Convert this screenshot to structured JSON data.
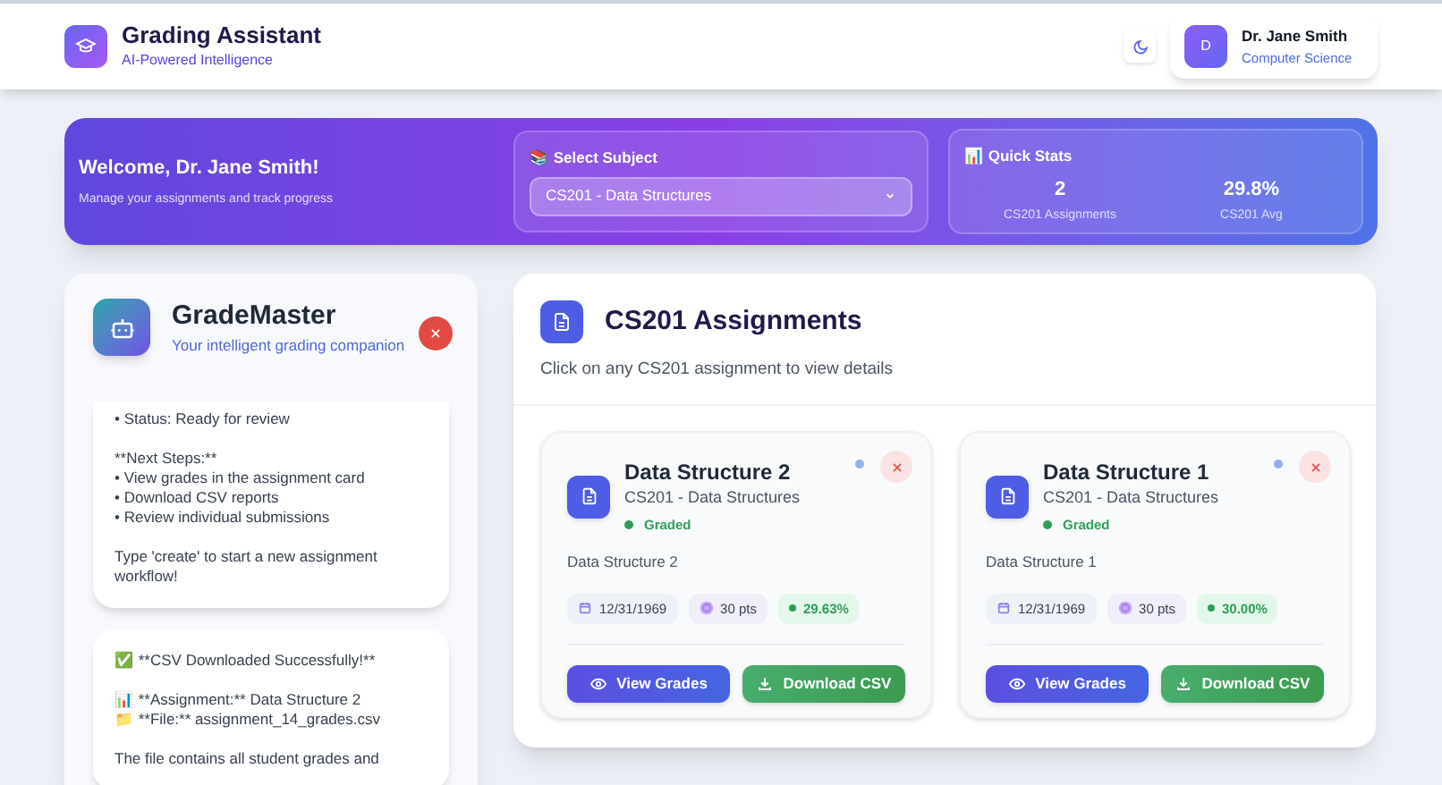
{
  "app": {
    "title": "Grading Assistant",
    "subtitle": "AI-Powered Intelligence"
  },
  "user": {
    "avatar_letter": "D",
    "name": "Dr. Jane Smith",
    "department": "Computer Science"
  },
  "banner": {
    "welcome": "Welcome, Dr. Jane Smith!",
    "tagline": "Manage your assignments and track progress",
    "subject_label": "📚 Select Subject",
    "subject_value": "CS201 - Data Structures",
    "stats_label": "📊 Quick Stats",
    "stats": [
      {
        "value": "2",
        "label": "CS201 Assignments"
      },
      {
        "value": "29.8%",
        "label": "CS201 Avg"
      }
    ]
  },
  "chat": {
    "title": "GradeMaster",
    "subtitle": "Your intelligent grading companion",
    "messages": [
      "• Status: Ready for review\n\n**Next Steps:**\n• View grades in the assignment card\n• Download CSV reports\n• Review individual submissions\n\nType 'create' to start a new assignment workflow!",
      "✅ **CSV Downloaded Successfully!**\n\n📊 **Assignment:** Data Structure 2\n📁 **File:** assignment_14_grades.csv\n\nThe file contains all student grades and"
    ]
  },
  "assignments": {
    "title": "CS201 Assignments",
    "subtitle": "Click on any CS201 assignment to view details",
    "cards": [
      {
        "title": "Data Structure 2",
        "course": "CS201 - Data Structures",
        "status": "Graded",
        "color": "#2f9e5a",
        "description": "Data Structure 2",
        "date": "12/31/1969",
        "points": "30 pts",
        "score": "29.63%",
        "actions": [
          "View Grades",
          "Download CSV"
        ]
      },
      {
        "title": "Data Structure 1",
        "course": "CS201 - Data Structures",
        "status": "Graded",
        "color": "#2f9e5a",
        "description": "Data Structure 1",
        "date": "12/31/1969",
        "points": "30 pts",
        "score": "30.00%",
        "actions": [
          "View Grades",
          "Download CSV"
        ]
      }
    ]
  }
}
